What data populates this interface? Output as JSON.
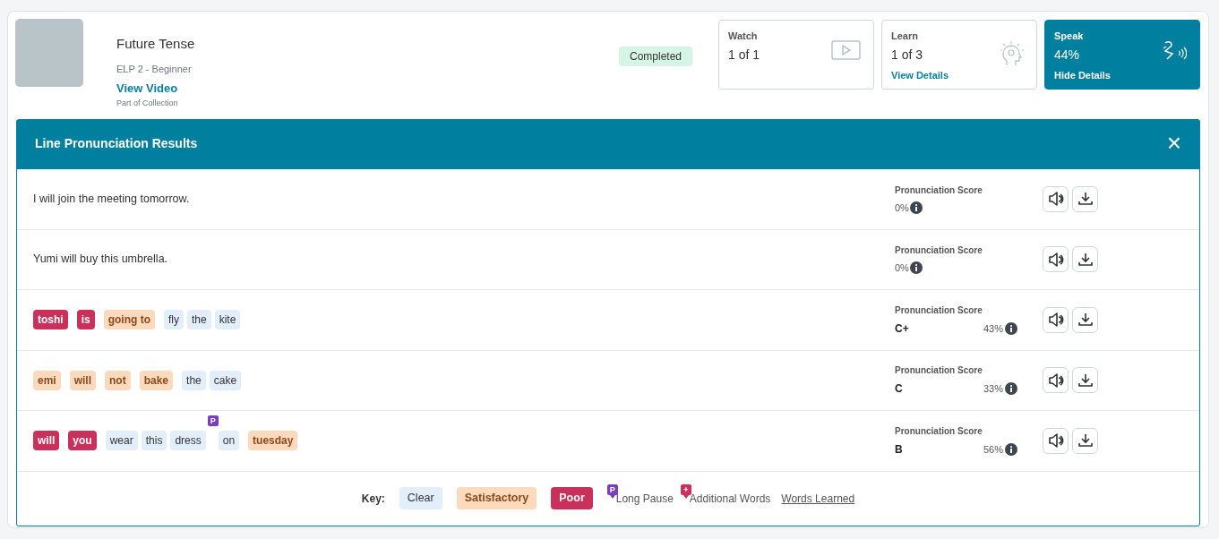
{
  "lesson": {
    "title": "Future Tense",
    "level": "ELP 2 - Beginner",
    "link": "View Video",
    "note": "Part of Collection",
    "status": "Completed"
  },
  "tiles": [
    {
      "kind": "watch",
      "label": "Watch",
      "value": "1 of 1",
      "selected": false
    },
    {
      "kind": "learn",
      "label": "Learn",
      "value": "1 of 3",
      "link": "View Details",
      "selected": false
    },
    {
      "kind": "speak",
      "label": "Speak",
      "value": "44%",
      "link": "Hide Details",
      "selected": true
    }
  ],
  "panel": {
    "title": "Line Pronunciation Results",
    "close": "×"
  },
  "lines": [
    {
      "kind": "plain",
      "text": "I will join the meeting tomorrow.",
      "score_label": "Pronunciation Score",
      "percent": "0%"
    },
    {
      "kind": "plain",
      "text": "Yumi will buy this umbrella.",
      "score_label": "Pronunciation Score",
      "percent": "0%"
    },
    {
      "kind": "words",
      "words": [
        {
          "text": "toshi",
          "kind": "poor"
        },
        {
          "text": "is",
          "kind": "poor"
        },
        {
          "text": "going to",
          "kind": "satisfactory"
        },
        {
          "text": "fly",
          "kind": "clear"
        },
        {
          "text": "the",
          "kind": "clear"
        },
        {
          "text": "kite",
          "kind": "clear"
        }
      ],
      "score_label": "Pronunciation Score",
      "grade": "C+",
      "percent": "43%"
    },
    {
      "kind": "words",
      "words": [
        {
          "text": "emi",
          "kind": "satisfactory"
        },
        {
          "text": "will",
          "kind": "satisfactory"
        },
        {
          "text": "not",
          "kind": "satisfactory"
        },
        {
          "text": "bake",
          "kind": "satisfactory"
        },
        {
          "text": "the",
          "kind": "clear"
        },
        {
          "text": "cake",
          "kind": "clear"
        }
      ],
      "score_label": "Pronunciation Score",
      "grade": "C",
      "percent": "33%"
    },
    {
      "kind": "words",
      "words": [
        {
          "text": "will",
          "kind": "poor"
        },
        {
          "text": "you",
          "kind": "poor"
        },
        {
          "text": "wear",
          "kind": "clear"
        },
        {
          "text": "this",
          "kind": "clear"
        },
        {
          "text": "dress",
          "kind": "clear",
          "pause": "P"
        },
        {
          "text": "on",
          "kind": "clear"
        },
        {
          "text": "tuesday",
          "kind": "satisfactory"
        }
      ],
      "score_label": "Pronunciation Score",
      "grade": "B",
      "percent": "56%"
    }
  ],
  "key": {
    "label": "Key:",
    "items": [
      {
        "kind": "clear",
        "text": "Clear"
      },
      {
        "kind": "satisfactory",
        "text": "Satisfactory"
      },
      {
        "kind": "poor",
        "text": "Poor"
      },
      {
        "kind": "pause",
        "mark": "P",
        "text": "Long Pause"
      },
      {
        "kind": "added",
        "mark": "+",
        "text": "Additional Words"
      },
      {
        "kind": "link",
        "text": "Words Learned"
      }
    ]
  }
}
